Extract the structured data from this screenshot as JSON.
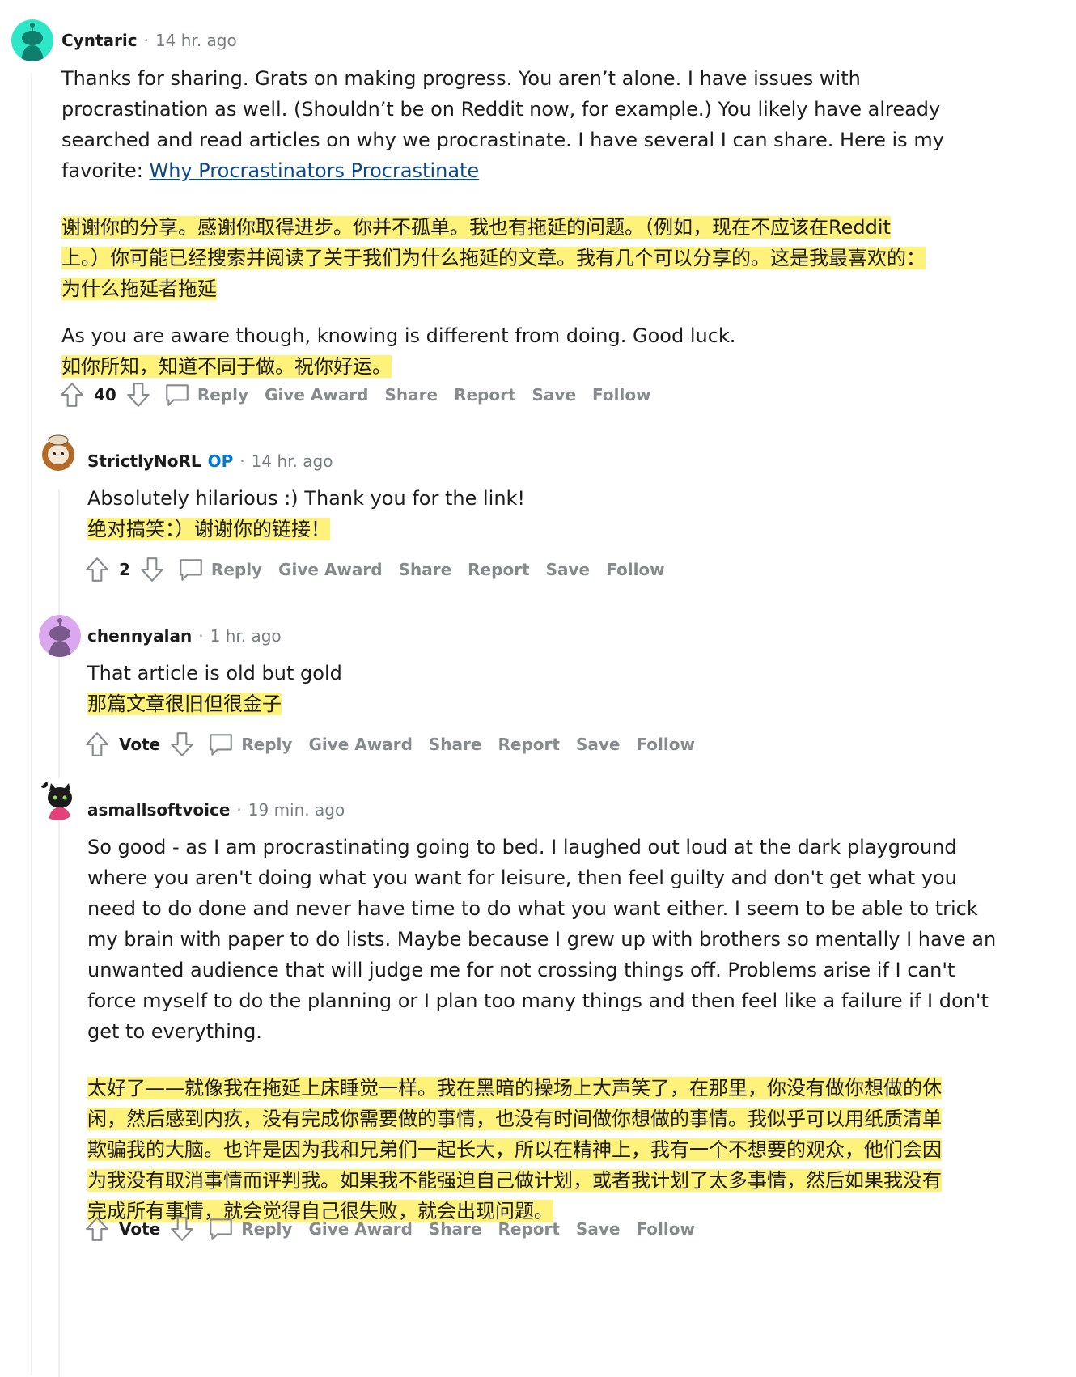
{
  "comments": [
    {
      "author": "Cyntaric",
      "time": "14 hr. ago",
      "body_en": [
        "Thanks for sharing. Grats on making progress. You aren’t alone. I have issues with",
        "procrastination as well. (Shouldn’t be on Reddit now, for example.) You likely have already",
        "searched and read articles on why we procrastinate. I have several I can share. Here is my"
      ],
      "body_en_last_prefix": "favorite: ",
      "link_text": "Why Procrastinators Procrastinate",
      "body_zh": [
        "谢谢你的分享。感谢你取得进步。你并不孤单。我也有拖延的问题。（例如，现在不应该在Reddit",
        "上。）你可能已经搜索并阅读了关于我们为什么拖延的文章。我有几个可以分享的。这是我最喜欢的：",
        "为什么拖延者拖延"
      ],
      "body_en2": "As you are aware though, knowing is different from doing. Good luck.",
      "body_zh2": "如你所知，知道不同于做。祝你好运。",
      "score": "40"
    },
    {
      "author": "StrictlyNoRL",
      "badge": "OP",
      "time": "14 hr. ago",
      "body_en": "Absolutely hilarious :) Thank you for the link!",
      "body_zh": "绝对搞笑：）谢谢你的链接！",
      "score": "2"
    },
    {
      "author": "chennyalan",
      "time": "1 hr. ago",
      "body_en": "That article is old but gold",
      "body_zh": "那篇文章很旧但很金子",
      "score": "Vote"
    },
    {
      "author": "asmallsoftvoice",
      "time": "19 min. ago",
      "body_en": [
        "So good - as I am procrastinating going to bed. I laughed out loud at the dark playground",
        "where you aren't doing what you want for leisure, then feel guilty and don't get what you",
        "need to do done and never have time to do what you want either. I seem to be able to trick",
        "my brain with paper to do lists. Maybe because I grew up with brothers so mentally I have an",
        "unwanted audience that will judge me for not crossing things off. Problems arise if I can't",
        "force myself to do the planning or I plan too many things and then feel like a failure if I don't",
        "get to everything."
      ],
      "body_zh": [
        "太好了——就像我在拖延上床睡觉一样。我在黑暗的操场上大声笑了，在那里，你没有做你想做的休",
        "闲，然后感到内疚，没有完成你需要做的事情，也没有时间做你想做的事情。我似乎可以用纸质清单",
        "欺骗我的大脑。也许是因为我和兄弟们一起长大，所以在精神上，我有一个不想要的观众，他们会因",
        "为我没有取消事情而评判我。如果我不能强迫自己做计划，或者我计划了太多事情，然后如果我没有",
        "完成所有事情，就会觉得自己很失败，就会出现问题。"
      ],
      "score": "Vote"
    }
  ],
  "actions": {
    "reply": "Reply",
    "give_award": "Give Award",
    "share": "Share",
    "report": "Report",
    "save": "Save",
    "follow": "Follow"
  },
  "colors": {
    "highlight": "#fff27a",
    "link": "#0a4a8c",
    "op_badge": "#0079d3",
    "muted": "#878a8c",
    "avatar_teal": "#2ee6c8",
    "avatar_purple": "#d9a8ee"
  },
  "icons": {
    "upvote": "arrow-up-outline-icon",
    "downvote": "arrow-down-outline-icon",
    "reply": "speech-bubble-icon"
  }
}
